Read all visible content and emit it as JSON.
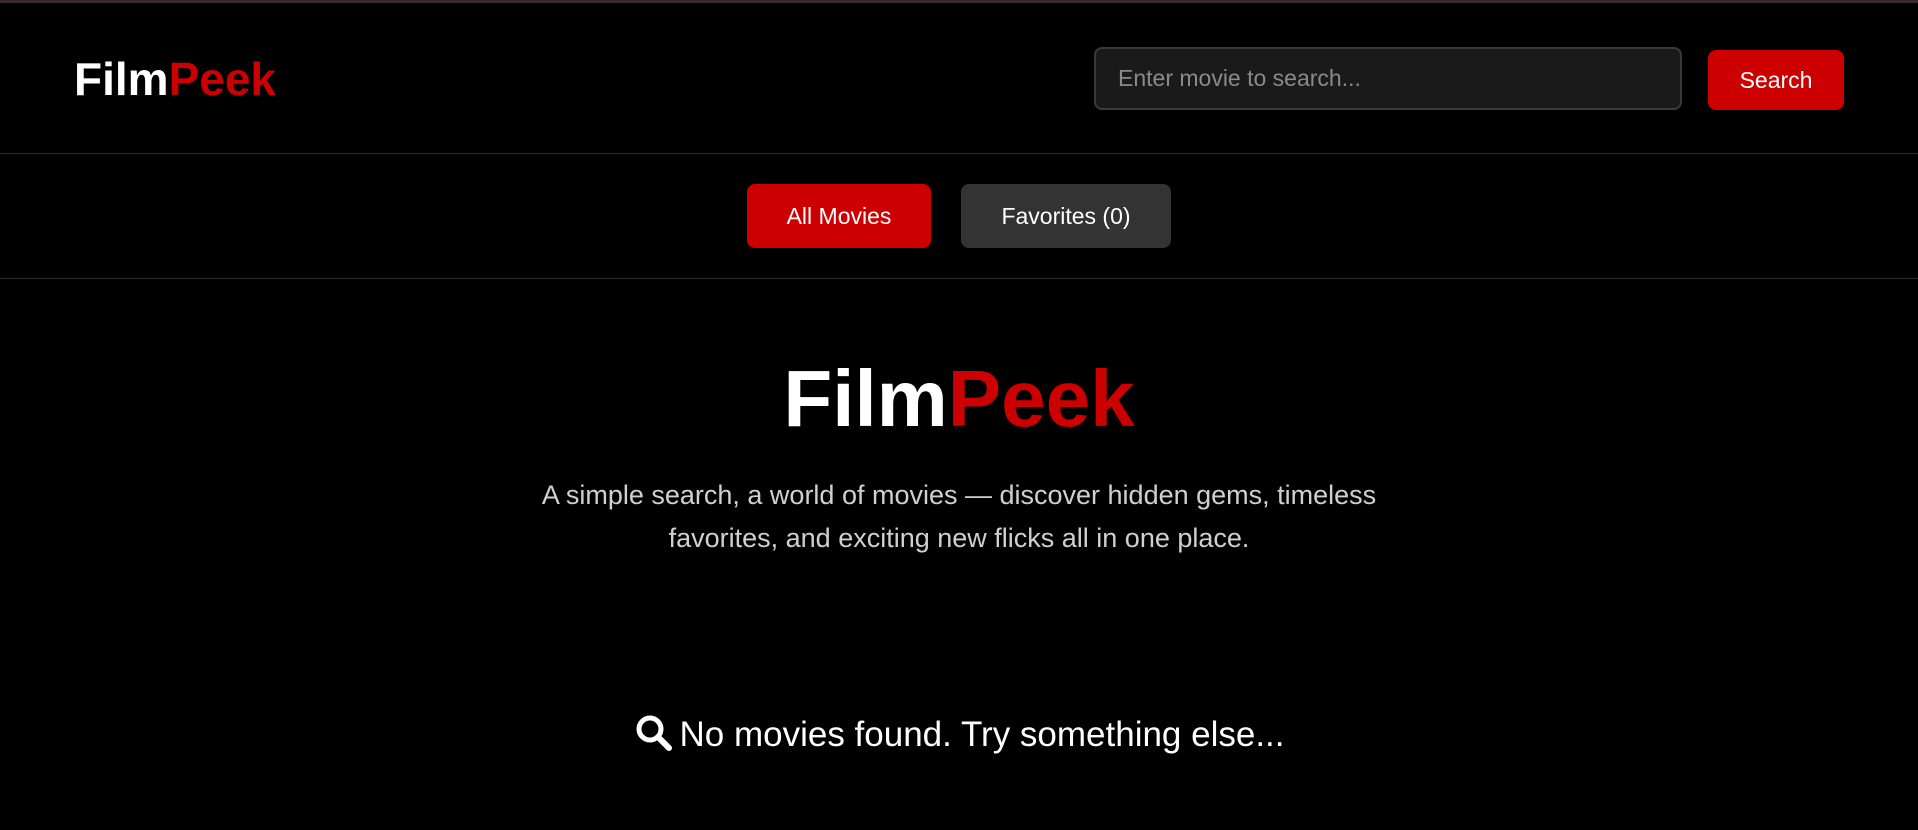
{
  "header": {
    "logo_part1": "Film",
    "logo_part2": "Peek",
    "search_placeholder": "Enter movie to search...",
    "search_button_label": "Search"
  },
  "tabs": [
    {
      "label": "All Movies",
      "active": true
    },
    {
      "label": "Favorites (0)",
      "active": false
    }
  ],
  "hero": {
    "title_part1": "Film",
    "title_part2": "Peek",
    "tagline": "A simple search, a world of movies — discover hidden gems, timeless favorites, and exciting new flicks all in one place."
  },
  "empty_state": {
    "icon": "search-icon",
    "message": "No movies found. Try something else..."
  },
  "colors": {
    "accent": "#cc0000",
    "background": "#000000",
    "tab_inactive": "#333333",
    "input_bg": "#1a1a1a"
  }
}
